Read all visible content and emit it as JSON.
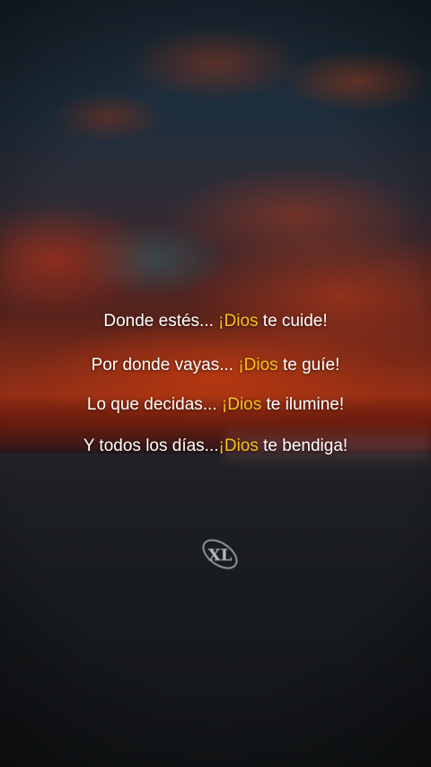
{
  "quote": {
    "lines": [
      {
        "before": "Donde estés... ",
        "highlight": "¡Dios",
        "after": " te cuide!"
      },
      {
        "before": "Por donde vayas... ",
        "highlight": "¡Dios",
        "after": " te guíe!"
      },
      {
        "before": "Lo que decidas... ",
        "highlight": "¡Dios",
        "after": " te ilumine!"
      },
      {
        "before": "Y todos los días...",
        "highlight": "¡Dios",
        "after": " te bendiga!"
      }
    ]
  },
  "colors": {
    "text": "#ffffff",
    "highlight": "#f7c21a"
  },
  "watermark": {
    "icon": "xl-logo-icon",
    "text": "XL"
  }
}
